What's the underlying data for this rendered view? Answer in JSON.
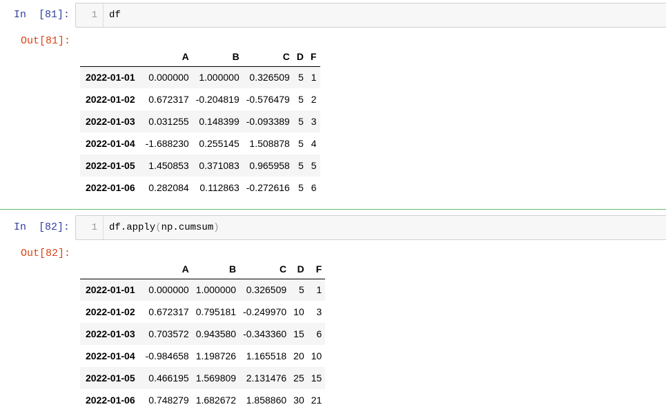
{
  "cells": [
    {
      "in_prompt": "In  [81]:",
      "out_prompt": "Out[81]:",
      "line_number": "1",
      "code": "df",
      "code_parts": [
        "df",
        "",
        "",
        ""
      ],
      "columns": [
        "A",
        "B",
        "C",
        "D",
        "F"
      ],
      "rows": [
        {
          "index": "2022-01-01",
          "values": [
            "0.000000",
            "1.000000",
            "0.326509",
            "5",
            "1"
          ]
        },
        {
          "index": "2022-01-02",
          "values": [
            "0.672317",
            "-0.204819",
            "-0.576479",
            "5",
            "2"
          ]
        },
        {
          "index": "2022-01-03",
          "values": [
            "0.031255",
            "0.148399",
            "-0.093389",
            "5",
            "3"
          ]
        },
        {
          "index": "2022-01-04",
          "values": [
            "-1.688230",
            "0.255145",
            "1.508878",
            "5",
            "4"
          ]
        },
        {
          "index": "2022-01-05",
          "values": [
            "1.450853",
            "0.371083",
            "0.965958",
            "5",
            "5"
          ]
        },
        {
          "index": "2022-01-06",
          "values": [
            "0.282084",
            "0.112863",
            "-0.272616",
            "5",
            "6"
          ]
        }
      ]
    },
    {
      "in_prompt": "In  [82]:",
      "out_prompt": "Out[82]:",
      "line_number": "1",
      "code": "df.apply(np.cumsum)",
      "code_parts": [
        "df.apply",
        "(",
        "np.cumsum",
        ")"
      ],
      "columns": [
        "A",
        "B",
        "C",
        "D",
        "F"
      ],
      "rows": [
        {
          "index": "2022-01-01",
          "values": [
            "0.000000",
            "1.000000",
            "0.326509",
            "5",
            "1"
          ]
        },
        {
          "index": "2022-01-02",
          "values": [
            "0.672317",
            "0.795181",
            "-0.249970",
            "10",
            "3"
          ]
        },
        {
          "index": "2022-01-03",
          "values": [
            "0.703572",
            "0.943580",
            "-0.343360",
            "15",
            "6"
          ]
        },
        {
          "index": "2022-01-04",
          "values": [
            "-0.984658",
            "1.198726",
            "1.165518",
            "20",
            "10"
          ]
        },
        {
          "index": "2022-01-05",
          "values": [
            "0.466195",
            "1.569809",
            "2.131476",
            "25",
            "15"
          ]
        },
        {
          "index": "2022-01-06",
          "values": [
            "0.748279",
            "1.682672",
            "1.858860",
            "30",
            "21"
          ]
        }
      ]
    }
  ],
  "colors": {
    "in_prompt": "#303f9f",
    "out_prompt": "#d84315",
    "selected_cell_border": "#66bb6a",
    "code_background": "#f7f7f7"
  }
}
